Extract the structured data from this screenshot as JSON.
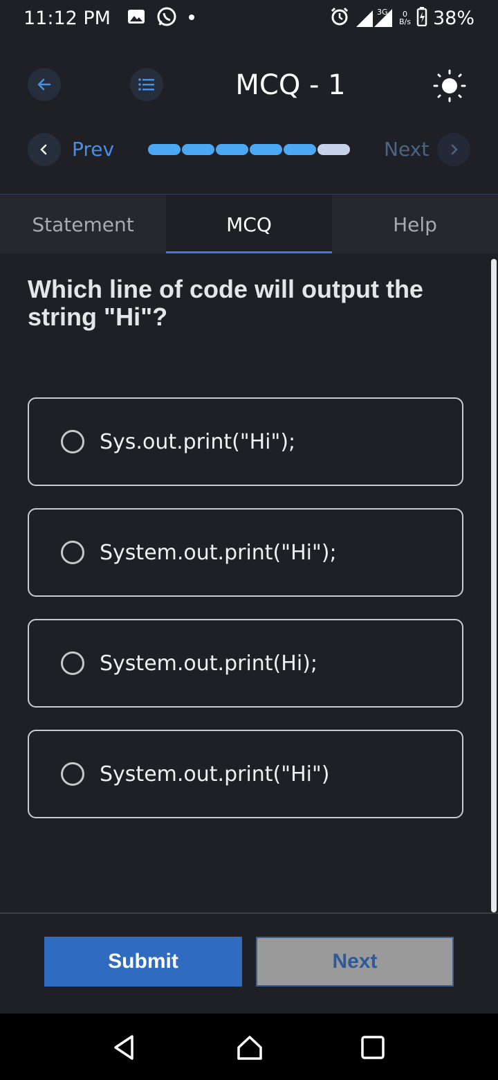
{
  "status_bar": {
    "time": "11:12 PM",
    "battery": "38%",
    "network_label": "3G",
    "data_rate": "0",
    "data_rate_unit": "B/s",
    "icons": [
      "gallery-icon",
      "whatsapp-icon",
      "notification-dot-icon",
      "alarm-icon",
      "signal-icon",
      "battery-icon"
    ]
  },
  "header": {
    "title": "MCQ - 1",
    "prev_label": "Prev",
    "next_label": "Next",
    "progress": {
      "total": 6,
      "completed": 5
    }
  },
  "tabs": [
    {
      "label": "Statement",
      "active": false
    },
    {
      "label": "MCQ",
      "active": true
    },
    {
      "label": "Help",
      "active": false
    }
  ],
  "question": "Which line of code will output the string \"Hi\"?",
  "options": [
    "Sys.out.print(\"Hi\");",
    "System.out.print(\"Hi\");",
    "System.out.print(Hi);",
    "System.out.print(\"Hi\")"
  ],
  "footer": {
    "submit_label": "Submit",
    "next_label": "Next"
  },
  "colors": {
    "background": "#1e2026",
    "accent": "#3d7be0",
    "progress_complete": "#4ba8f5",
    "progress_pending": "#c5d2ea",
    "submit": "#2f6bbf"
  }
}
